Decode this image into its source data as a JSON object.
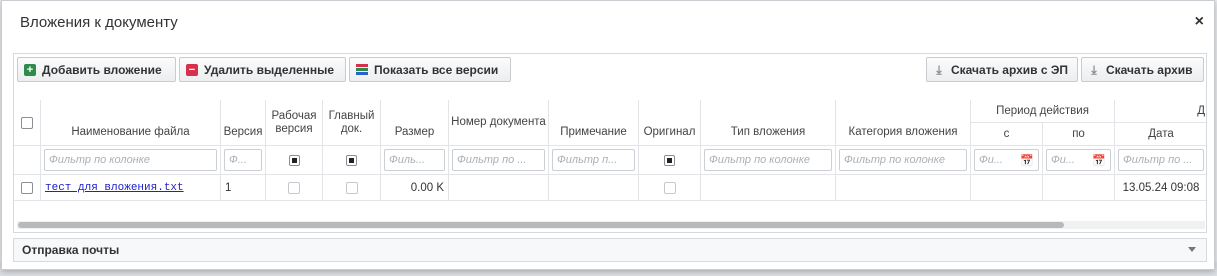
{
  "dialog": {
    "title": "Вложения к документу",
    "close_symbol": "×"
  },
  "toolbar": {
    "add": "Добавить вложение",
    "delete": "Удалить выделенные",
    "show_versions": "Показать все версии",
    "download_archive_ep": "Скачать архив с ЭП",
    "download_archive": "Скачать архив"
  },
  "grid": {
    "headers": {
      "name": "Наименование файла",
      "version": "Версия",
      "working_version": "Рабочая версия",
      "main_doc": "Главный док.",
      "size": "Размер",
      "doc_number": "Номер документа",
      "note": "Примечание",
      "original": "Оригинал",
      "attach_type": "Тип вложения",
      "attach_category": "Категория вложения",
      "period": "Период действия",
      "period_from": "с",
      "period_to": "по",
      "date": "Дата",
      "extra": "Д"
    },
    "filters": {
      "name": "Фильтр по колонке",
      "version": "Ф...",
      "size": "Филь...",
      "doc_number": "Фильтр по ...",
      "note": "Фильтр п...",
      "attach_type": "Фильтр по колонке",
      "attach_category": "Фильтр по колонке",
      "period_from": "Фи...",
      "period_to": "Фи...",
      "date": "Фильтр по ..."
    },
    "rows": [
      {
        "name": "тест для вложения.txt",
        "version": "1",
        "size": "0.00 K",
        "date": "13.05.24 09:08"
      }
    ]
  },
  "mail_section": {
    "label": "Отправка почты"
  },
  "icons": {
    "add": "plus-icon",
    "delete": "minus-icon",
    "versions": "bars-icon",
    "download": "download-icon",
    "calendar": "calendar-icon"
  },
  "colors": {
    "add_icon": "#2e8b4a",
    "delete_icon": "#d6304c",
    "link": "#2121c9"
  }
}
